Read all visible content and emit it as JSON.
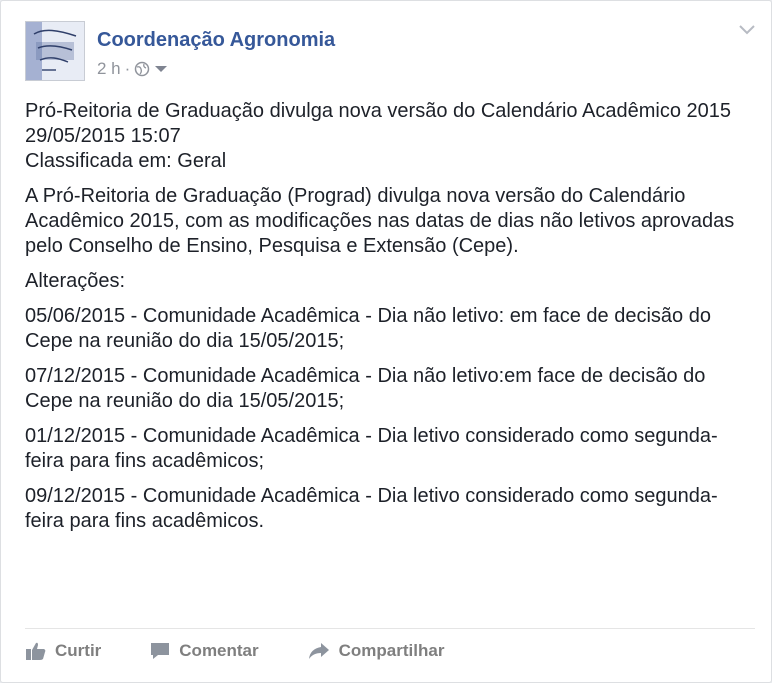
{
  "post": {
    "page_name": "Coordenação Agronomia",
    "time": "2 h",
    "title": "Pró-Reitoria de Graduação divulga nova versão do Calendário Acadêmico 2015",
    "date": "29/05/2015 15:07",
    "category": "Classificada em: Geral",
    "intro": "A Pró-Reitoria de Graduação (Prograd) divulga nova versão do Calendário Acadêmico 2015, com as modificações nas datas de dias não letivos aprovadas pelo Conselho de Ensino, Pesquisa e Extensão (Cepe).",
    "changes_label": "Alterações:",
    "changes": [
      "05/06/2015 - Comunidade Acadêmica - Dia não letivo: em face de decisão do Cepe na reunião do dia 15/05/2015;",
      "07/12/2015 - Comunidade Acadêmica - Dia não letivo:em face de decisão do Cepe na reunião do dia 15/05/2015;",
      "01/12/2015 - Comunidade Acadêmica - Dia letivo considerado como segunda-feira para fins acadêmicos;",
      "09/12/2015 - Comunidade Acadêmica - Dia letivo considerado como segunda-feira para fins acadêmicos."
    ]
  },
  "actions": {
    "like": "Curtir",
    "comment": "Comentar",
    "share": "Compartilhar"
  },
  "colors": {
    "link": "#365899",
    "muted": "#90949c",
    "text": "#1d2129"
  }
}
